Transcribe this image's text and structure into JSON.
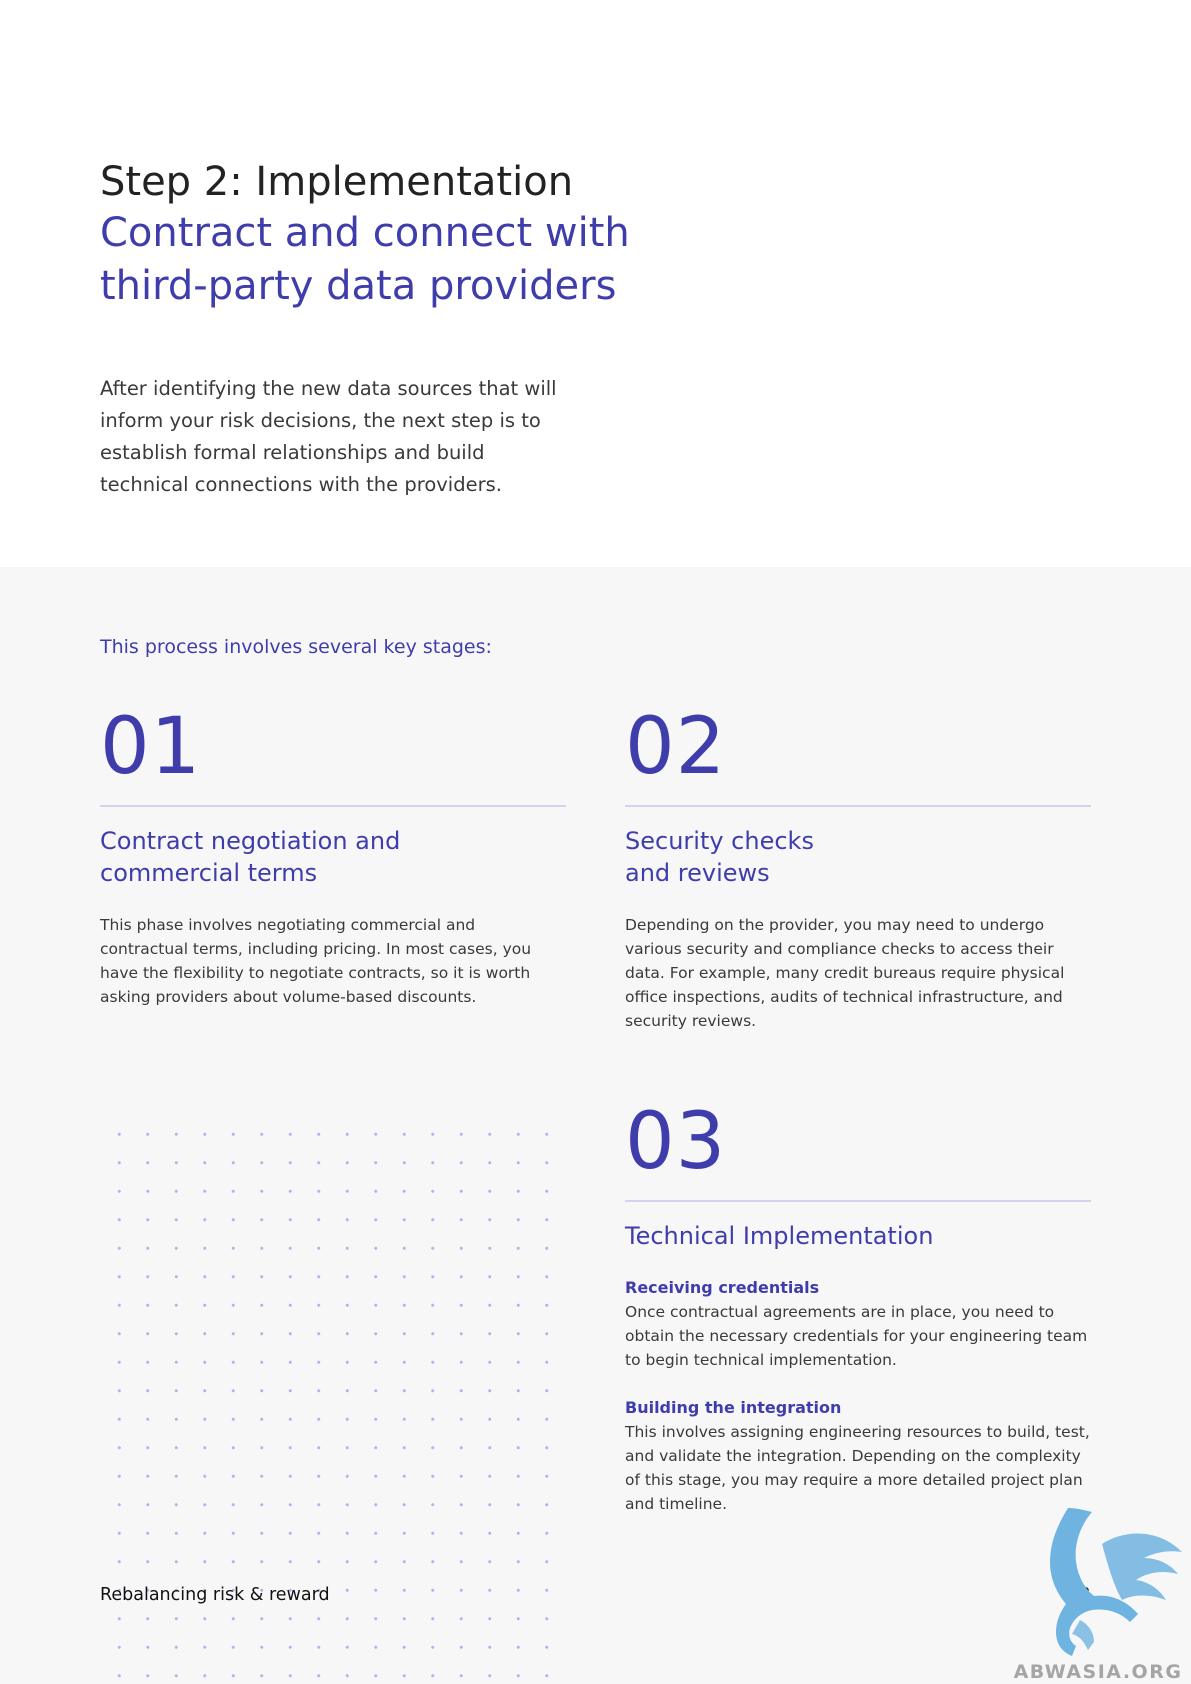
{
  "header": {
    "step_title": "Step 2: Implementation",
    "heading_lines": [
      "Contract and connect with",
      "third-party data providers"
    ]
  },
  "intro": "After identifying the new data sources that will inform your risk decisions, the next step is to establish formal relationships and build technical connections with the providers.",
  "stages_lead": "This process involves several key stages:",
  "stages": [
    {
      "number": "01",
      "title_lines": [
        "Contract negotiation and",
        "commercial terms"
      ],
      "body": "This phase involves negotiating commercial and contractual terms, including pricing. In most cases, you have the flexibility to negotiate contracts, so it is worth asking providers about volume-based discounts."
    },
    {
      "number": "02",
      "title_lines": [
        "Security checks",
        "and reviews"
      ],
      "body": "Depending on the provider, you may need to undergo various security and compliance checks to access their data. For example, many credit bureaus require physical office inspections, audits of technical infrastructure, and security reviews."
    },
    {
      "number": "03",
      "title_lines": [
        "Technical Implementation"
      ],
      "subsections": [
        {
          "heading": "Receiving credentials",
          "body": "Once contractual agreements are in place, you need to obtain the necessary credentials for your engineering team to begin technical implementation."
        },
        {
          "heading": "Building the integration",
          "body": "This involves assigning engineering resources to build, test, and validate the integration. Depending on the complexity of this stage, you may require a more detailed project plan and timeline."
        }
      ]
    }
  ],
  "footer": {
    "title": "Rebalancing risk & reward",
    "page_number": "28"
  },
  "watermark": {
    "text": "ABWASIA.ORG",
    "icon": "griffin-logo-icon",
    "color": "#6fb3e0"
  },
  "colors": {
    "accent": "#3f3dac",
    "body_text": "#3a3a3a",
    "rule": "#d4d3ee",
    "panel_background": "#f7f7f8",
    "dot": "#b5b3ec"
  }
}
